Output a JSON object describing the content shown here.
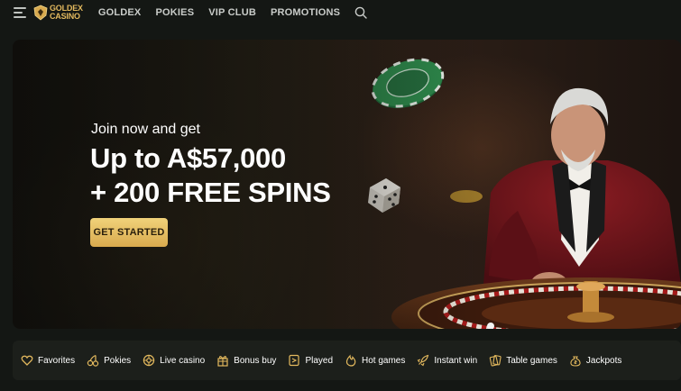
{
  "header": {
    "logo": {
      "line1": "GOLDEX",
      "line2": "CASINO"
    },
    "nav": [
      "GOLDEX",
      "POKIES",
      "VIP CLUB",
      "PROMOTIONS"
    ]
  },
  "hero": {
    "subtitle": "Join now and get",
    "title_line1": "Up to A$57,000",
    "title_line2": "+ 200 FREE SPINS",
    "cta_label": "GET STARTED"
  },
  "categories": [
    {
      "label": "Favorites",
      "icon": "heart-icon"
    },
    {
      "label": "Pokies",
      "icon": "cherries-icon"
    },
    {
      "label": "Live casino",
      "icon": "roulette-icon"
    },
    {
      "label": "Bonus buy",
      "icon": "gift-icon"
    },
    {
      "label": "Played",
      "icon": "card-icon"
    },
    {
      "label": "Hot games",
      "icon": "flame-icon"
    },
    {
      "label": "Instant win",
      "icon": "rocket-icon"
    },
    {
      "label": "Table games",
      "icon": "cards-icon"
    },
    {
      "label": "Jackpots",
      "icon": "moneybag-icon"
    }
  ],
  "colors": {
    "accent": "#e3b95e",
    "cta_top": "#f0d27a",
    "cta_bottom": "#d9aa4e",
    "background": "#141714"
  }
}
